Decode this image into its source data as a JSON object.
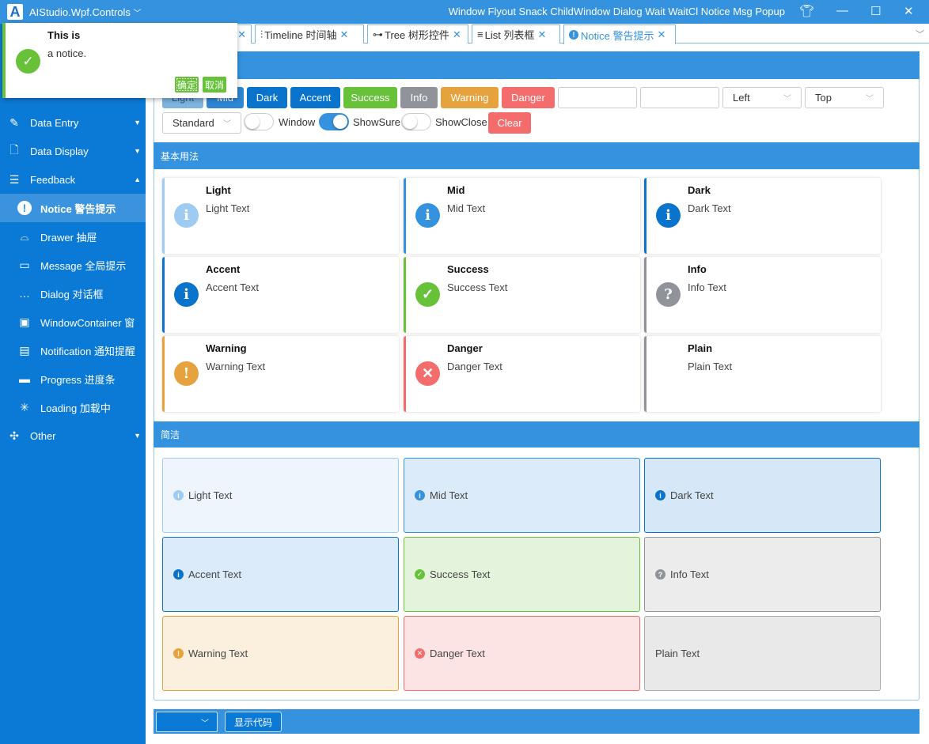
{
  "titlebar": {
    "app": "AIStudio.Wpf.Controls",
    "menu": "Window Flyout Snack ChildWindow Dialog Wait WaitCl Notice Msg Popup",
    "icons": [
      "shirt-icon",
      "minimize-icon",
      "maximize-icon",
      "close-icon"
    ]
  },
  "tabs": [
    {
      "label": "Timeline 时间轴",
      "icon": "⫶"
    },
    {
      "label": "Tree 树形控件",
      "icon": "⊶"
    },
    {
      "label": "List 列表框",
      "icon": "≡"
    },
    {
      "label": "Notice 警告提示",
      "icon": "!"
    }
  ],
  "sidebar": {
    "groups": [
      {
        "label": "Data Entry",
        "icon": "✎"
      },
      {
        "label": "Data Display",
        "icon": "🗋"
      },
      {
        "label": "Feedback",
        "icon": "☰"
      },
      {
        "label": "Other",
        "icon": "✣"
      }
    ],
    "items": [
      {
        "label": "Notice 警告提示",
        "icon": "!"
      },
      {
        "label": "Drawer 抽屉",
        "icon": "⌓"
      },
      {
        "label": "Message 全局提示",
        "icon": "▭"
      },
      {
        "label": "Dialog 对话框",
        "icon": "…"
      },
      {
        "label": "WindowContainer 窗",
        "icon": "▣"
      },
      {
        "label": "Notification 通知提醒",
        "icon": "▤"
      },
      {
        "label": "Progress 进度条",
        "icon": "▬"
      },
      {
        "label": "Loading 加载中",
        "icon": "✳"
      }
    ]
  },
  "toolbar": {
    "buttons": [
      {
        "label": "Light",
        "color": "#7fb3e0"
      },
      {
        "label": "Mid",
        "color": "#2f86d4"
      },
      {
        "label": "Dark",
        "color": "#0a73cc"
      },
      {
        "label": "Accent",
        "color": "#0a73cc"
      },
      {
        "label": "Success",
        "color": "#67c23a"
      },
      {
        "label": "Info",
        "color": "#909399"
      },
      {
        "label": "Warning",
        "color": "#e6a23c"
      },
      {
        "label": "Danger",
        "color": "#f56c6c"
      }
    ],
    "title_input": "",
    "content_input": "",
    "h_align": "Left",
    "v_align": "Top",
    "style": "Standard",
    "toggles": [
      {
        "label": "Window",
        "on": false
      },
      {
        "label": "ShowSure",
        "on": true
      },
      {
        "label": "ShowClose",
        "on": false
      }
    ],
    "clear": "Clear"
  },
  "sections": {
    "basic": "基本用法",
    "simple": "简洁"
  },
  "cards": [
    {
      "title": "Light",
      "text": "Light Text",
      "color": "#9dcbf2",
      "icon": "i",
      "bg": "#eef5fc"
    },
    {
      "title": "Mid",
      "text": "Mid Text",
      "color": "#3592de",
      "icon": "i",
      "bg": "#dcebf9"
    },
    {
      "title": "Dark",
      "text": "Dark Text",
      "color": "#0a73cc",
      "icon": "i",
      "bg": "#d6e8f8"
    },
    {
      "title": "Accent",
      "text": "Accent Text",
      "color": "#0a73cc",
      "icon": "i",
      "bg": "#dcebf9"
    },
    {
      "title": "Success",
      "text": "Success Text",
      "color": "#67c23a",
      "icon": "✓",
      "bg": "#e4f4dc"
    },
    {
      "title": "Info",
      "text": "Info Text",
      "color": "#909399",
      "icon": "?",
      "bg": "#ececec"
    },
    {
      "title": "Warning",
      "text": "Warning Text",
      "color": "#e6a23c",
      "icon": "!",
      "bg": "#fbefdd"
    },
    {
      "title": "Danger",
      "text": "Danger Text",
      "color": "#f56c6c",
      "icon": "✕",
      "bg": "#fde4e4"
    },
    {
      "title": "Plain",
      "text": "Plain Text",
      "color": "#909399",
      "icon": "",
      "bg": "#e9e9e9"
    }
  ],
  "notice": {
    "title": "This is",
    "message": "a notice.",
    "ok": "确定",
    "cancel": "取消",
    "color": "#67c23a"
  },
  "bottom": {
    "select": "",
    "show_code": "显示代码"
  }
}
